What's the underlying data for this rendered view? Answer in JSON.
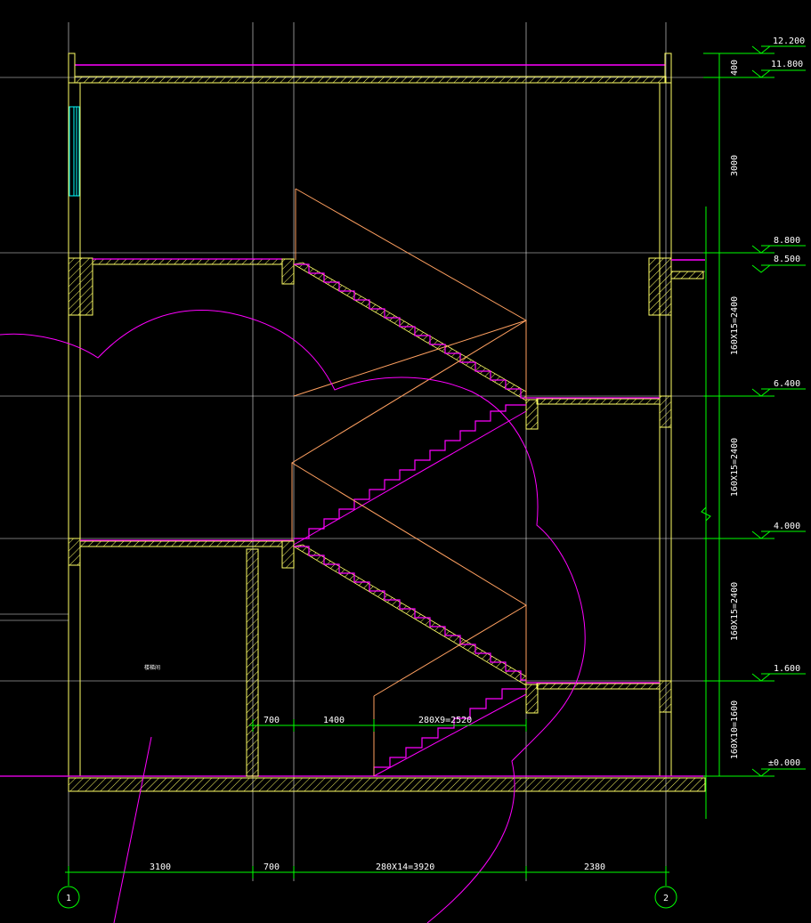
{
  "levels": {
    "l1": "12.200",
    "l2": "11.800",
    "l3": "8.800",
    "l4": "8.500",
    "l5": "6.400",
    "l6": "4.000",
    "l7": "1.600",
    "l8": "±0.000"
  },
  "right_dims": {
    "d1": "400",
    "d2": "3000",
    "d3": "160X15=2400",
    "d4": "160X15=2400",
    "d5": "160X15=2400",
    "d6": "160X10=1600"
  },
  "bottom_dims": {
    "b1": "3100",
    "b2": "700",
    "b3": "280X14=3920",
    "b4": "2380"
  },
  "inner_dims": {
    "i1": "700",
    "i2": "1400",
    "i3": "280X9=2520"
  },
  "axes": {
    "a1": "1",
    "a2": "2"
  },
  "room_label": "楼梯间",
  "colors": {
    "background": "#000000",
    "grid": "#e8e8e8",
    "wall": "#ffff66",
    "magenta": "#ff00ff",
    "green": "#00ff00",
    "orange": "#ffa060",
    "cyan": "#00ffff"
  }
}
